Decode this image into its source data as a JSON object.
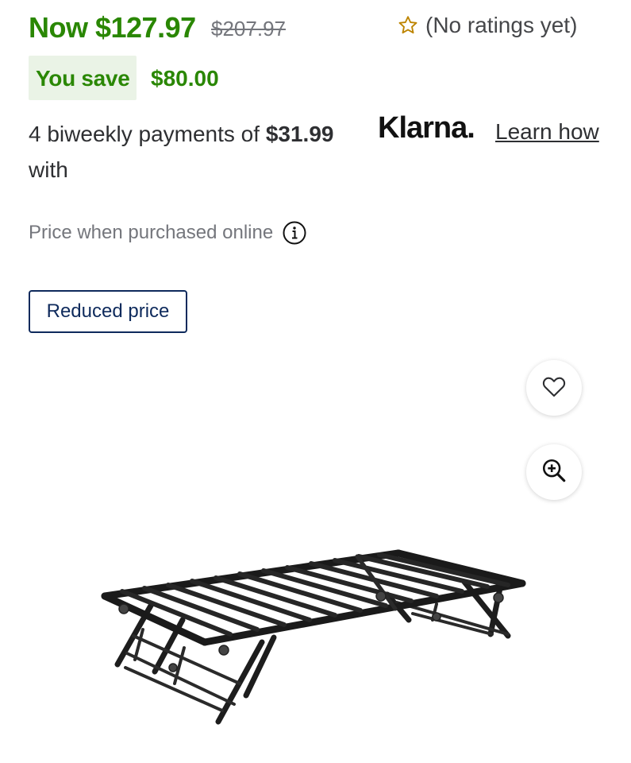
{
  "price": {
    "now": "Now $127.97",
    "was": "$207.97"
  },
  "rating": {
    "text": "(No ratings yet)",
    "icon": "star-outline-icon"
  },
  "savings": {
    "label": "You save",
    "amount": "$80.00"
  },
  "payments": {
    "prefix": "4 biweekly payments of",
    "amount": "$31.99",
    "suffix": "with",
    "provider": "Klarna.",
    "link": "Learn how"
  },
  "online_note": {
    "text": "Price when purchased online",
    "icon": "info-icon"
  },
  "badge": {
    "label": "Reduced price"
  },
  "actions": {
    "favorite_icon": "heart-icon",
    "zoom_icon": "zoom-in-icon"
  },
  "colors": {
    "accent_green": "#2a8703",
    "save_bg": "#eaf3e6",
    "badge_blue": "#0e2a5c",
    "rating_star": "#bd8400"
  }
}
